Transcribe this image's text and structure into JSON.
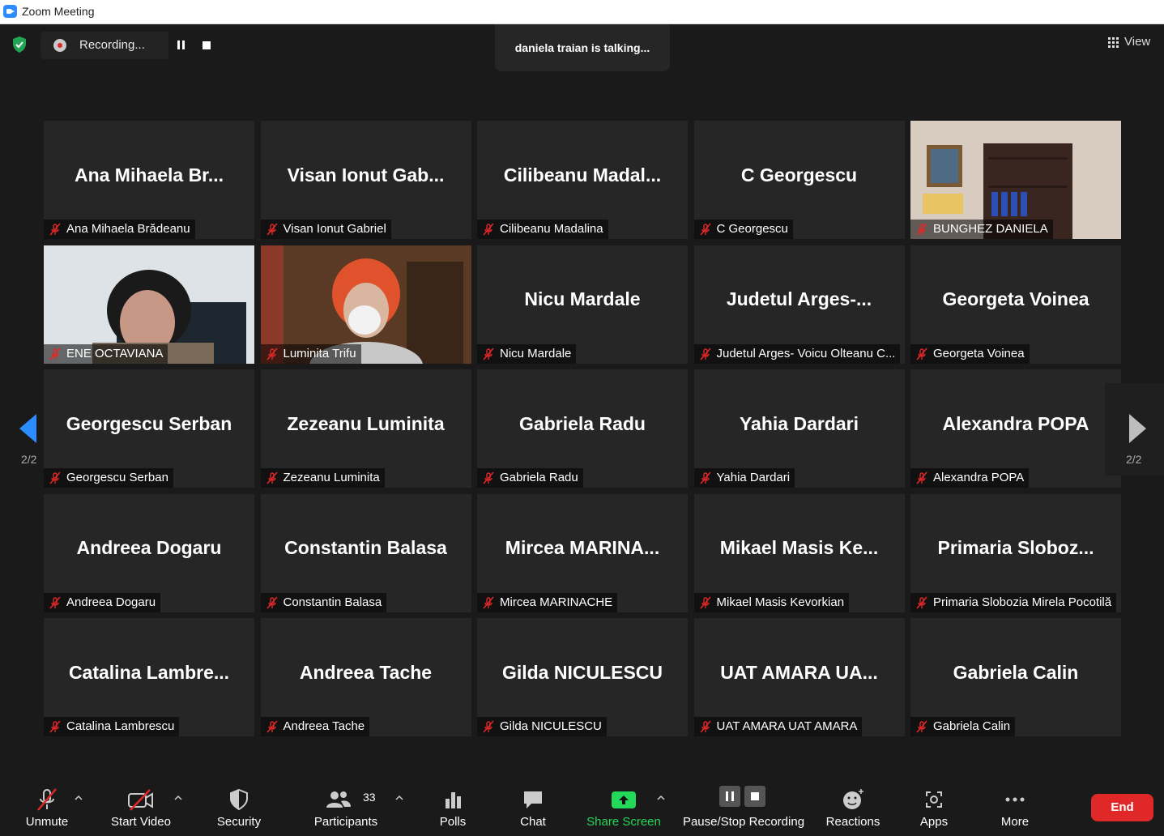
{
  "window": {
    "title": "Zoom Meeting"
  },
  "topbar": {
    "recording_label": "Recording...",
    "talking_text": "daniela traian is talking...",
    "view_label": "View"
  },
  "pager": {
    "left_indicator": "2/2",
    "right_indicator": "2/2"
  },
  "participants": [
    {
      "display": "Ana  Mihaela  Br...",
      "tag": "Ana Mihaela Brădeanu",
      "video": false
    },
    {
      "display": "Visan  Ionut  Gab...",
      "tag": "Visan Ionut Gabriel",
      "video": false
    },
    {
      "display": "Cilibeanu  Madal...",
      "tag": "Cilibeanu Madalina",
      "video": false
    },
    {
      "display": "C Georgescu",
      "tag": "C Georgescu",
      "video": false
    },
    {
      "display": "",
      "tag": "BUNGHEZ DANIELA",
      "video": true
    },
    {
      "display": "",
      "tag": "ENE OCTAVIANA",
      "video": true
    },
    {
      "display": "",
      "tag": "Luminita Trifu",
      "video": true
    },
    {
      "display": "Nicu Mardale",
      "tag": "Nicu Mardale",
      "video": false
    },
    {
      "display": "Judetul  Arges-...",
      "tag": "Judetul Arges- Voicu Olteanu C...",
      "video": false
    },
    {
      "display": "Georgeta Voinea",
      "tag": "Georgeta Voinea",
      "video": false
    },
    {
      "display": "Georgescu Serban",
      "tag": "Georgescu Serban",
      "video": false
    },
    {
      "display": "Zezeanu Luminita",
      "tag": "Zezeanu Luminita",
      "video": false
    },
    {
      "display": "Gabriela Radu",
      "tag": "Gabriela Radu",
      "video": false
    },
    {
      "display": "Yahia Dardari",
      "tag": "Yahia Dardari",
      "video": false
    },
    {
      "display": "Alexandra POPA",
      "tag": "Alexandra POPA",
      "video": false
    },
    {
      "display": "Andreea Dogaru",
      "tag": "Andreea Dogaru",
      "video": false
    },
    {
      "display": "Constantin Balasa",
      "tag": "Constantin Balasa",
      "video": false
    },
    {
      "display": "Mircea  MARINA...",
      "tag": "Mircea MARINACHE",
      "video": false
    },
    {
      "display": "Mikael  Masis  Ke...",
      "tag": "Mikael Masis Kevorkian",
      "video": false
    },
    {
      "display": "Primaria  Sloboz...",
      "tag": "Primaria Slobozia Mirela Pocotilă",
      "video": false
    },
    {
      "display": "Catalina  Lambre...",
      "tag": "Catalina Lambrescu",
      "video": false
    },
    {
      "display": "Andreea Tache",
      "tag": "Andreea Tache",
      "video": false
    },
    {
      "display": "Gilda NICULESCU",
      "tag": "Gilda NICULESCU",
      "video": false
    },
    {
      "display": "UAT  AMARA  UA...",
      "tag": "UAT AMARA UAT AMARA",
      "video": false
    },
    {
      "display": "Gabriela Calin",
      "tag": "Gabriela Calin",
      "video": false
    }
  ],
  "toolbar": {
    "unmute": "Unmute",
    "start_video": "Start Video",
    "security": "Security",
    "participants": "Participants",
    "participants_count": "33",
    "polls": "Polls",
    "chat": "Chat",
    "share_screen": "Share Screen",
    "pause_stop": "Pause/Stop Recording",
    "reactions": "Reactions",
    "apps": "Apps",
    "more": "More",
    "end": "End"
  },
  "colors": {
    "accent": "#2d8cff",
    "share_green": "#23d959",
    "end_red": "#e02828",
    "tile_bg": "#262626",
    "bg": "#1a1a1a"
  }
}
